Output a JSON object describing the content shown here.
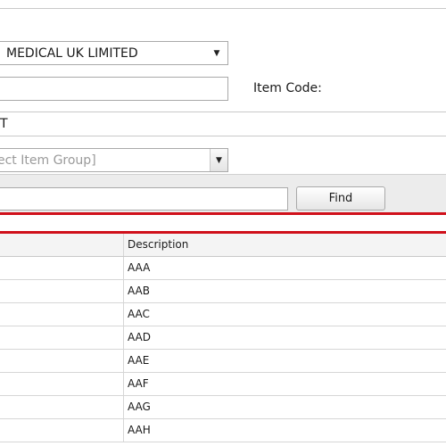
{
  "form": {
    "company_value": "MEDICAL UK LIMITED",
    "item_code_label": "Item Code:",
    "type_value": "T",
    "item_group_placeholder": "ect Item Group]",
    "find_label": "Find"
  },
  "grid": {
    "header_description": "Description",
    "rows": [
      "AAA",
      "AAB",
      "AAC",
      "AAD",
      "AAE",
      "AAF",
      "AAG",
      "AAH"
    ]
  },
  "colors": {
    "accent_red": "#d0101a",
    "band_gray": "#ececec"
  }
}
